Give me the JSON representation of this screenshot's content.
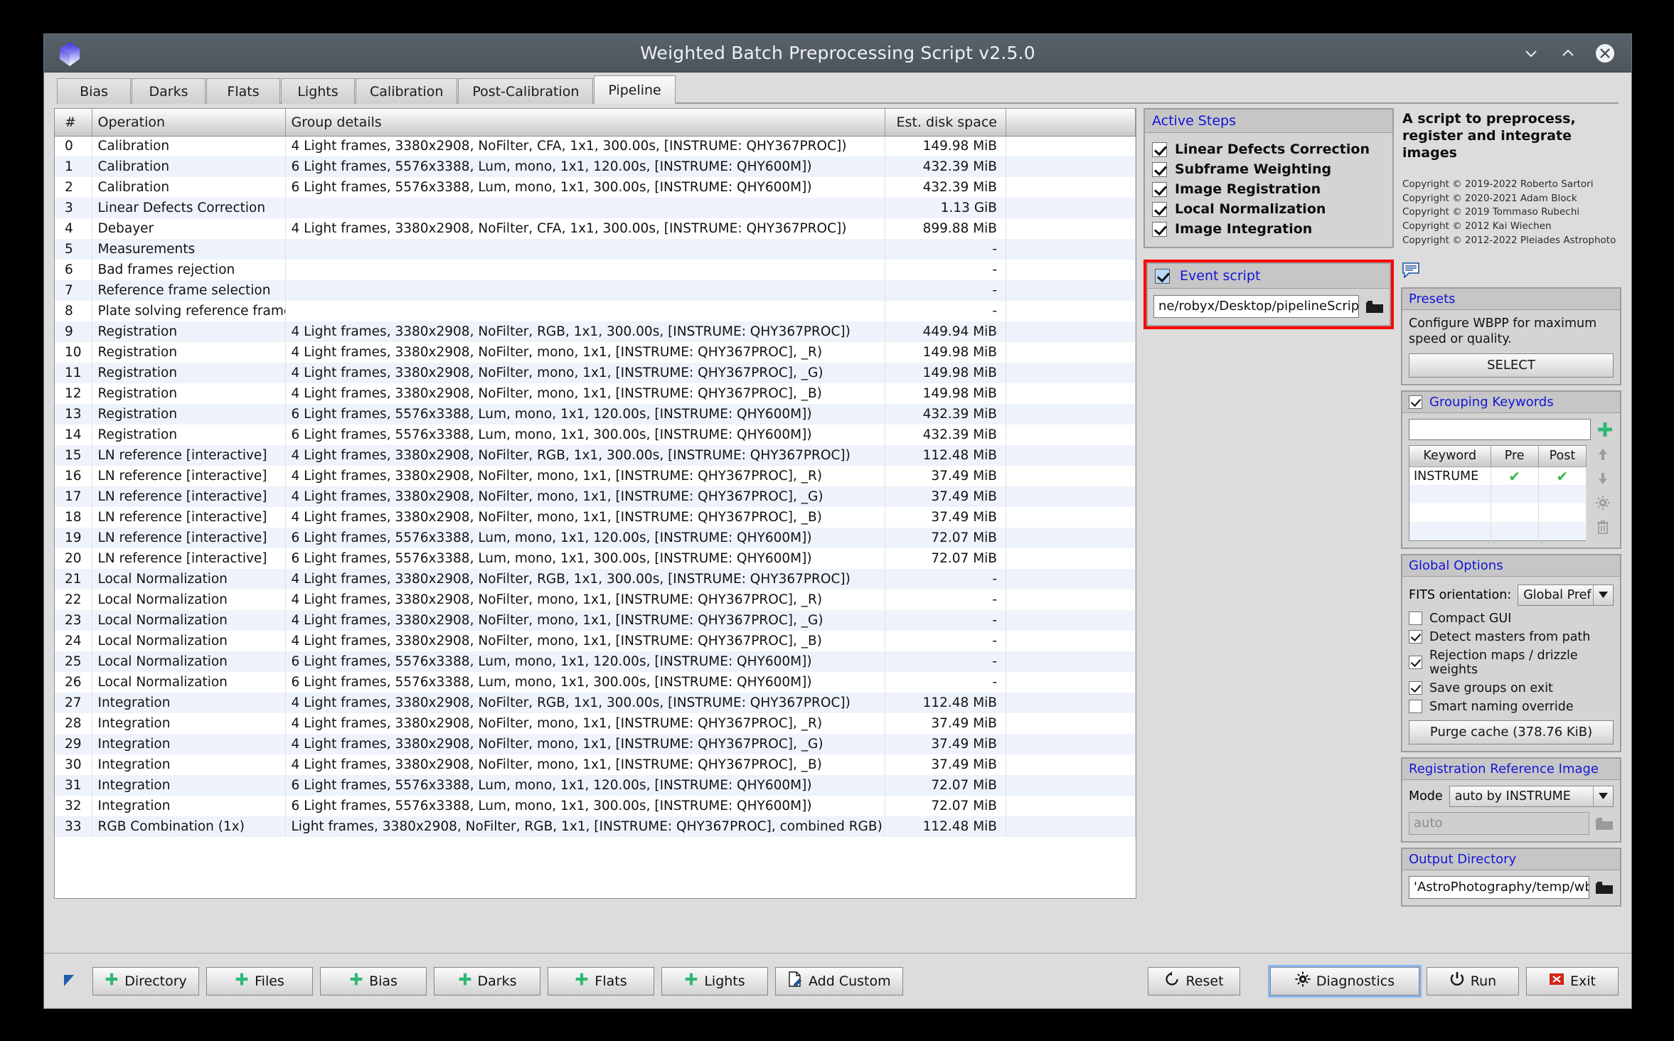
{
  "window": {
    "title": "Weighted Batch Preprocessing Script v2.5.0",
    "logo_icon": "pixinsight-cube-icon",
    "controls": [
      {
        "name": "minimize-button",
        "icon": "chevron-down-icon"
      },
      {
        "name": "maximize-button",
        "icon": "chevron-up-icon"
      },
      {
        "name": "close-button",
        "icon": "close-circle-icon"
      }
    ]
  },
  "tabs": [
    {
      "label": "Bias",
      "active": false
    },
    {
      "label": "Darks",
      "active": false
    },
    {
      "label": "Flats",
      "active": false
    },
    {
      "label": "Lights",
      "active": false
    },
    {
      "label": "Calibration",
      "active": false
    },
    {
      "label": "Post-Calibration",
      "active": false
    },
    {
      "label": "Pipeline",
      "active": true
    }
  ],
  "table": {
    "columns": [
      "#",
      "Operation",
      "Group details",
      "Est. disk space",
      ""
    ],
    "rows": [
      {
        "n": "0",
        "op": "Calibration",
        "grp": "4 Light frames, 3380x2908, NoFilter, CFA, 1x1, 300.00s, [INSTRUME: QHY367PROC])",
        "disk": "149.98 MiB"
      },
      {
        "n": "1",
        "op": "Calibration",
        "grp": "6 Light frames, 5576x3388, Lum, mono, 1x1, 120.00s, [INSTRUME: QHY600M])",
        "disk": "432.39 MiB"
      },
      {
        "n": "2",
        "op": "Calibration",
        "grp": "6 Light frames, 5576x3388, Lum, mono, 1x1, 300.00s, [INSTRUME: QHY600M])",
        "disk": "432.39 MiB"
      },
      {
        "n": "3",
        "op": "Linear Defects Correction",
        "grp": "",
        "disk": "1.13 GiB"
      },
      {
        "n": "4",
        "op": "Debayer",
        "grp": "4 Light frames, 3380x2908, NoFilter, CFA, 1x1, 300.00s, [INSTRUME: QHY367PROC])",
        "disk": "899.88 MiB"
      },
      {
        "n": "5",
        "op": "Measurements",
        "grp": "",
        "disk": "-"
      },
      {
        "n": "6",
        "op": "Bad frames rejection",
        "grp": "",
        "disk": "-"
      },
      {
        "n": "7",
        "op": "Reference frame selection",
        "grp": "",
        "disk": "-"
      },
      {
        "n": "8",
        "op": "Plate solving reference frames",
        "grp": "",
        "disk": "-"
      },
      {
        "n": "9",
        "op": "Registration",
        "grp": "4 Light frames, 3380x2908, NoFilter, RGB, 1x1, 300.00s, [INSTRUME: QHY367PROC])",
        "disk": "449.94 MiB"
      },
      {
        "n": "10",
        "op": "Registration",
        "grp": "4 Light frames, 3380x2908, NoFilter, mono, 1x1, [INSTRUME: QHY367PROC], _R)",
        "disk": "149.98 MiB"
      },
      {
        "n": "11",
        "op": "Registration",
        "grp": "4 Light frames, 3380x2908, NoFilter, mono, 1x1, [INSTRUME: QHY367PROC], _G)",
        "disk": "149.98 MiB"
      },
      {
        "n": "12",
        "op": "Registration",
        "grp": "4 Light frames, 3380x2908, NoFilter, mono, 1x1, [INSTRUME: QHY367PROC], _B)",
        "disk": "149.98 MiB"
      },
      {
        "n": "13",
        "op": "Registration",
        "grp": "6 Light frames, 5576x3388, Lum, mono, 1x1, 120.00s, [INSTRUME: QHY600M])",
        "disk": "432.39 MiB"
      },
      {
        "n": "14",
        "op": "Registration",
        "grp": "6 Light frames, 5576x3388, Lum, mono, 1x1, 300.00s, [INSTRUME: QHY600M])",
        "disk": "432.39 MiB"
      },
      {
        "n": "15",
        "op": "LN reference [interactive]",
        "grp": "4 Light frames, 3380x2908, NoFilter, RGB, 1x1, 300.00s, [INSTRUME: QHY367PROC])",
        "disk": "112.48 MiB"
      },
      {
        "n": "16",
        "op": "LN reference [interactive]",
        "grp": "4 Light frames, 3380x2908, NoFilter, mono, 1x1, [INSTRUME: QHY367PROC], _R)",
        "disk": "37.49 MiB"
      },
      {
        "n": "17",
        "op": "LN reference [interactive]",
        "grp": "4 Light frames, 3380x2908, NoFilter, mono, 1x1, [INSTRUME: QHY367PROC], _G)",
        "disk": "37.49 MiB"
      },
      {
        "n": "18",
        "op": "LN reference [interactive]",
        "grp": "4 Light frames, 3380x2908, NoFilter, mono, 1x1, [INSTRUME: QHY367PROC], _B)",
        "disk": "37.49 MiB"
      },
      {
        "n": "19",
        "op": "LN reference [interactive]",
        "grp": "6 Light frames, 5576x3388, Lum, mono, 1x1, 120.00s, [INSTRUME: QHY600M])",
        "disk": "72.07 MiB"
      },
      {
        "n": "20",
        "op": "LN reference [interactive]",
        "grp": "6 Light frames, 5576x3388, Lum, mono, 1x1, 300.00s, [INSTRUME: QHY600M])",
        "disk": "72.07 MiB"
      },
      {
        "n": "21",
        "op": "Local Normalization",
        "grp": "4 Light frames, 3380x2908, NoFilter, RGB, 1x1, 300.00s, [INSTRUME: QHY367PROC])",
        "disk": "-"
      },
      {
        "n": "22",
        "op": "Local Normalization",
        "grp": "4 Light frames, 3380x2908, NoFilter, mono, 1x1, [INSTRUME: QHY367PROC], _R)",
        "disk": "-"
      },
      {
        "n": "23",
        "op": "Local Normalization",
        "grp": "4 Light frames, 3380x2908, NoFilter, mono, 1x1, [INSTRUME: QHY367PROC], _G)",
        "disk": "-"
      },
      {
        "n": "24",
        "op": "Local Normalization",
        "grp": "4 Light frames, 3380x2908, NoFilter, mono, 1x1, [INSTRUME: QHY367PROC], _B)",
        "disk": "-"
      },
      {
        "n": "25",
        "op": "Local Normalization",
        "grp": "6 Light frames, 5576x3388, Lum, mono, 1x1, 120.00s, [INSTRUME: QHY600M])",
        "disk": "-"
      },
      {
        "n": "26",
        "op": "Local Normalization",
        "grp": "6 Light frames, 5576x3388, Lum, mono, 1x1, 300.00s, [INSTRUME: QHY600M])",
        "disk": "-"
      },
      {
        "n": "27",
        "op": "Integration",
        "grp": "4 Light frames, 3380x2908, NoFilter, RGB, 1x1, 300.00s, [INSTRUME: QHY367PROC])",
        "disk": "112.48 MiB"
      },
      {
        "n": "28",
        "op": "Integration",
        "grp": "4 Light frames, 3380x2908, NoFilter, mono, 1x1, [INSTRUME: QHY367PROC], _R)",
        "disk": "37.49 MiB"
      },
      {
        "n": "29",
        "op": "Integration",
        "grp": "4 Light frames, 3380x2908, NoFilter, mono, 1x1, [INSTRUME: QHY367PROC], _G)",
        "disk": "37.49 MiB"
      },
      {
        "n": "30",
        "op": "Integration",
        "grp": "4 Light frames, 3380x2908, NoFilter, mono, 1x1, [INSTRUME: QHY367PROC], _B)",
        "disk": "37.49 MiB"
      },
      {
        "n": "31",
        "op": "Integration",
        "grp": "6 Light frames, 5576x3388, Lum, mono, 1x1, 120.00s, [INSTRUME: QHY600M])",
        "disk": "72.07 MiB"
      },
      {
        "n": "32",
        "op": "Integration",
        "grp": "6 Light frames, 5576x3388, Lum, mono, 1x1, 300.00s, [INSTRUME: QHY600M])",
        "disk": "72.07 MiB"
      },
      {
        "n": "33",
        "op": "RGB Combination (1x)",
        "grp": "Light frames, 3380x2908, NoFilter, RGB, 1x1, [INSTRUME: QHY367PROC], combined RGB)",
        "disk": "112.48 MiB"
      }
    ]
  },
  "active_steps": {
    "title": "Active Steps",
    "items": [
      {
        "label": "Linear Defects Correction",
        "checked": true
      },
      {
        "label": "Subframe Weighting",
        "checked": true
      },
      {
        "label": "Image Registration",
        "checked": true
      },
      {
        "label": "Local Normalization",
        "checked": true
      },
      {
        "label": "Image Integration",
        "checked": true
      }
    ]
  },
  "event_script": {
    "title": "Event script",
    "checked": true,
    "path": "ne/robyx/Desktop/pipelineScript.js",
    "browse_icon": "folder-icon",
    "highlight_color": "#ff0000"
  },
  "intro": {
    "heading": "A script to preprocess, register and integrate images",
    "copyrights": [
      "Copyright © 2019-2022 Roberto Sartori",
      "Copyright © 2020-2021 Adam Block",
      "Copyright © 2019 Tommaso Rubechi",
      "Copyright © 2012 Kai Wiechen",
      "Copyright © 2012-2022 Pleiades Astrophoto"
    ],
    "bubble_icon": "comment-icon"
  },
  "presets": {
    "title": "Presets",
    "description": "Configure WBPP for maximum speed or quality.",
    "button": "SELECT"
  },
  "grouping_keywords": {
    "title": "Grouping Keywords",
    "checked": true,
    "input_value": "",
    "add_icon": "plus-icon",
    "columns": [
      "Keyword",
      "Pre",
      "Post"
    ],
    "rows": [
      {
        "keyword": "INSTRUME",
        "pre": "✔",
        "post": "✔"
      }
    ],
    "empty_rows": 3,
    "tools": [
      {
        "name": "move-up-icon"
      },
      {
        "name": "move-down-icon"
      },
      {
        "name": "settings-gear-icon"
      },
      {
        "name": "delete-trash-icon"
      }
    ],
    "check_color": "#3bb54a"
  },
  "global_options": {
    "title": "Global Options",
    "fits_label": "FITS orientation:",
    "fits_value": "Global Pref",
    "checks": [
      {
        "label": "Compact GUI",
        "checked": false
      },
      {
        "label": "Detect masters from path",
        "checked": true
      },
      {
        "label": "Rejection maps / drizzle weights",
        "checked": true
      },
      {
        "label": "Save groups on exit",
        "checked": true
      },
      {
        "label": "Smart naming override",
        "checked": false
      }
    ],
    "purge_button": "Purge cache (378.76 KiB)"
  },
  "registration_reference": {
    "title": "Registration Reference Image",
    "mode_label": "Mode",
    "mode_value": "auto by INSTRUME",
    "path_placeholder": "auto",
    "browse_icon": "folder-icon"
  },
  "output_directory": {
    "title": "Output Directory",
    "path": "'AstroPhotography/temp/wbpp",
    "browse_icon": "folder-icon"
  },
  "bottom_bar": {
    "left_buttons": [
      {
        "label": "Directory",
        "icon": "plus-icon"
      },
      {
        "label": "Files",
        "icon": "plus-icon"
      },
      {
        "label": "Bias",
        "icon": "plus-icon"
      },
      {
        "label": "Darks",
        "icon": "plus-icon"
      },
      {
        "label": "Flats",
        "icon": "plus-icon"
      },
      {
        "label": "Lights",
        "icon": "plus-icon"
      },
      {
        "label": "Add Custom",
        "icon": "document-pencil-icon"
      }
    ],
    "right_buttons": [
      {
        "label": "Reset",
        "icon": "reset-icon"
      },
      {
        "label": "Diagnostics",
        "icon": "gear-icon"
      },
      {
        "label": "Run",
        "icon": "power-icon"
      },
      {
        "label": "Exit",
        "icon": "close-red-icon"
      }
    ],
    "resize_icon": "resize-corner-icon"
  }
}
